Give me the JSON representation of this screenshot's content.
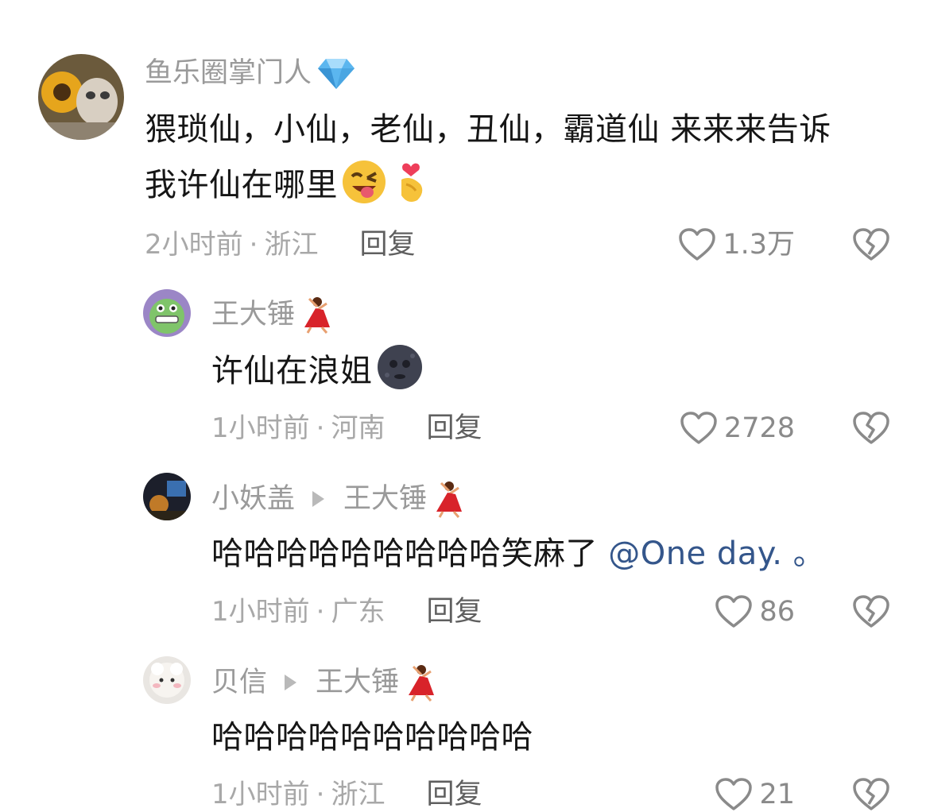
{
  "comments": [
    {
      "username": "鱼乐圈掌门人",
      "badge_icon": "diamond-icon",
      "text": "猥琐仙，小仙，老仙，丑仙，霸道仙 来来来告诉我许仙在哪里",
      "text_line1": "猥琐仙，小仙，老仙，丑仙，霸道仙 来来来告诉",
      "text_line2": "我许仙在哪里",
      "emojis": [
        "winking-tongue-emoji",
        "finger-heart-emoji"
      ],
      "time": "2小时前",
      "location": "浙江",
      "reply_label": "回复",
      "likes": "1.3万"
    },
    {
      "username": "王大锤",
      "badge_icon": "dancer-emoji",
      "text": "许仙在浪姐",
      "emojis": [
        "new-moon-face-emoji"
      ],
      "time": "1小时前",
      "location": "河南",
      "reply_label": "回复",
      "likes": "2728"
    },
    {
      "username": "小妖盖",
      "reply_to": "王大锤",
      "badge_icon": "dancer-emoji",
      "text": "哈哈哈哈哈哈哈哈哈笑麻了",
      "mention": "@One day. 。",
      "time": "1小时前",
      "location": "广东",
      "reply_label": "回复",
      "likes": "86"
    },
    {
      "username": "贝信",
      "reply_to": "王大锤",
      "badge_icon": "dancer-emoji",
      "text": "哈哈哈哈哈哈哈哈哈哈",
      "time": "1小时前",
      "location": "浙江",
      "reply_label": "回复",
      "likes": "21"
    }
  ],
  "separator": "·",
  "colors": {
    "username": "#9a9a9a",
    "text": "#161616",
    "mention": "#34568b",
    "meta": "#a8a8a8",
    "reply": "#5f5f5f"
  }
}
